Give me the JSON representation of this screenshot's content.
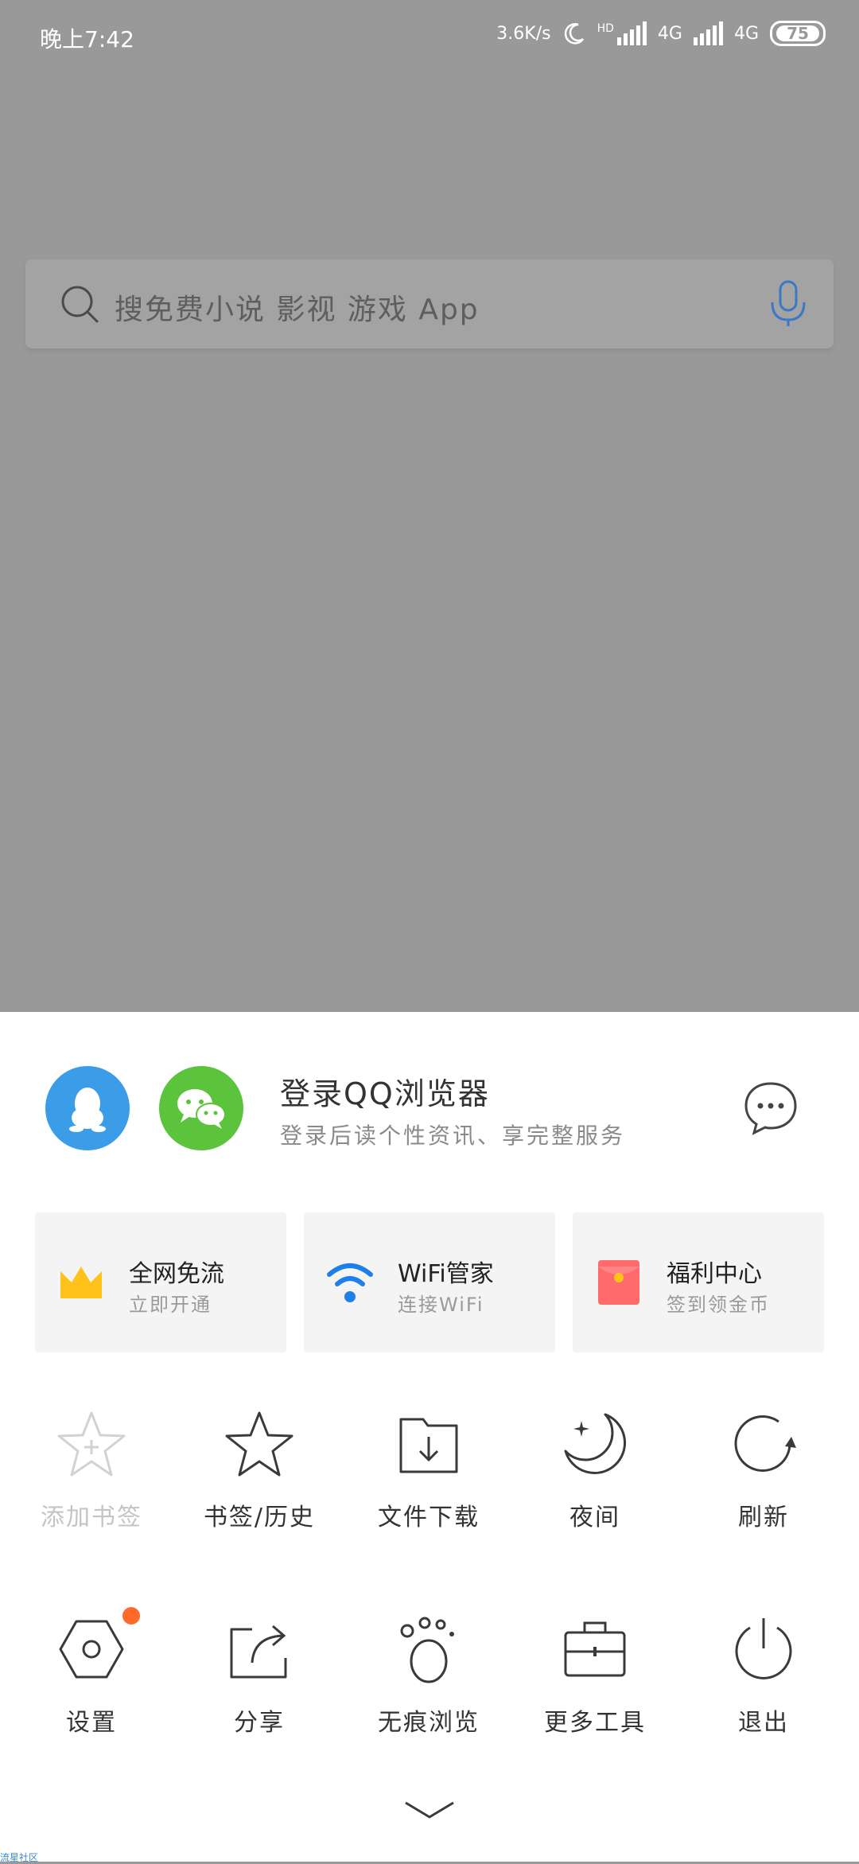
{
  "status_bar": {
    "time": "晚上7:42",
    "net_speed": "3.6K/s",
    "hd": "HD",
    "net1": "4G",
    "net2": "4G",
    "battery": "75"
  },
  "search": {
    "placeholder": "搜免费小说 影视 游戏 App",
    "mic_color": "#3b78c8"
  },
  "login": {
    "title": "登录QQ浏览器",
    "subtitle": "登录后读个性资讯、享完整服务",
    "qq_color": "#3b9de8",
    "wechat_color": "#5cc43c"
  },
  "cards": [
    {
      "title": "全网免流",
      "subtitle": "立即开通",
      "icon": "crown-icon"
    },
    {
      "title": "WiFi管家",
      "subtitle": "连接WiFi",
      "icon": "wifi-icon"
    },
    {
      "title": "福利中心",
      "subtitle": "签到领金币",
      "icon": "red-envelope-icon"
    }
  ],
  "grid_row1": [
    {
      "label": "添加书签",
      "icon": "add-bookmark-icon",
      "disabled": true
    },
    {
      "label": "书签/历史",
      "icon": "star-icon"
    },
    {
      "label": "文件下载",
      "icon": "download-folder-icon"
    },
    {
      "label": "夜间",
      "icon": "moon-icon"
    },
    {
      "label": "刷新",
      "icon": "refresh-icon"
    }
  ],
  "grid_row2": [
    {
      "label": "设置",
      "icon": "settings-icon",
      "badge": true
    },
    {
      "label": "分享",
      "icon": "share-icon"
    },
    {
      "label": "无痕浏览",
      "icon": "paw-icon"
    },
    {
      "label": "更多工具",
      "icon": "toolbox-icon"
    },
    {
      "label": "退出",
      "icon": "power-icon"
    }
  ],
  "watermark": "流星社区",
  "colors": {
    "overlay": "#999999",
    "badge": "#ff6a2a",
    "crown": "#ffc21a",
    "wifi": "#1f7fe8",
    "envelope": "#ff6b6b"
  }
}
